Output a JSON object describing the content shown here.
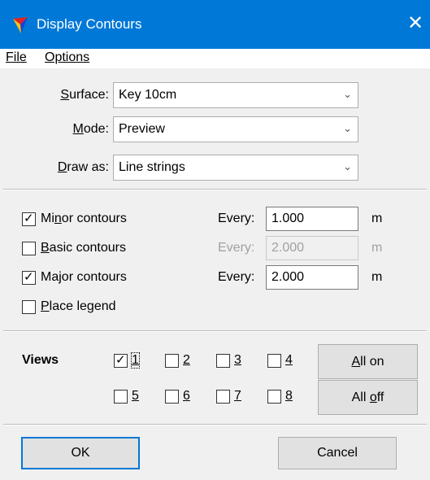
{
  "window": {
    "title": "Display Contours",
    "close_glyph": "✕",
    "app_icon": "tin-triangle-icon"
  },
  "menu": {
    "file": "File",
    "options": "Options"
  },
  "surface": {
    "label_pre": "",
    "label_u": "S",
    "label_post": "urface:",
    "value": "Key 10cm"
  },
  "mode": {
    "label_pre": "",
    "label_u": "M",
    "label_post": "ode:",
    "value": "Preview"
  },
  "draw_as": {
    "label_pre": "",
    "label_u": "D",
    "label_post": "raw as:",
    "value": "Line strings"
  },
  "contours": {
    "minor": {
      "checked": true,
      "pre": "Mi",
      "u": "n",
      "post": "or contours",
      "every_label": "Every:",
      "every_value": "1.000",
      "unit": "m"
    },
    "basic": {
      "checked": false,
      "pre": "",
      "u": "B",
      "post": "asic contours",
      "every_label": "Every:",
      "every_value": "2.000",
      "unit": "m",
      "disabled": true
    },
    "major": {
      "checked": true,
      "pre": "Ma",
      "u": "j",
      "post": "or contours",
      "every_label": "Every:",
      "every_value": "2.000",
      "unit": "m"
    },
    "legend": {
      "checked": false,
      "pre": "",
      "u": "P",
      "post": "lace legend"
    }
  },
  "views": {
    "label": "Views",
    "items": [
      {
        "label": "1",
        "checked": true
      },
      {
        "label": "2",
        "checked": false
      },
      {
        "label": "3",
        "checked": false
      },
      {
        "label": "4",
        "checked": false
      },
      {
        "label": "5",
        "checked": false
      },
      {
        "label": "6",
        "checked": false
      },
      {
        "label": "7",
        "checked": false
      },
      {
        "label": "8",
        "checked": false
      }
    ],
    "all_on": {
      "u": "A",
      "post": "ll on"
    },
    "all_off": {
      "pre": "All ",
      "u": "o",
      "post": "ff"
    }
  },
  "buttons": {
    "ok": "OK",
    "cancel": "Cancel"
  },
  "colors": {
    "titlebar": "#0078d7",
    "default_button_border": "#0078d7"
  }
}
